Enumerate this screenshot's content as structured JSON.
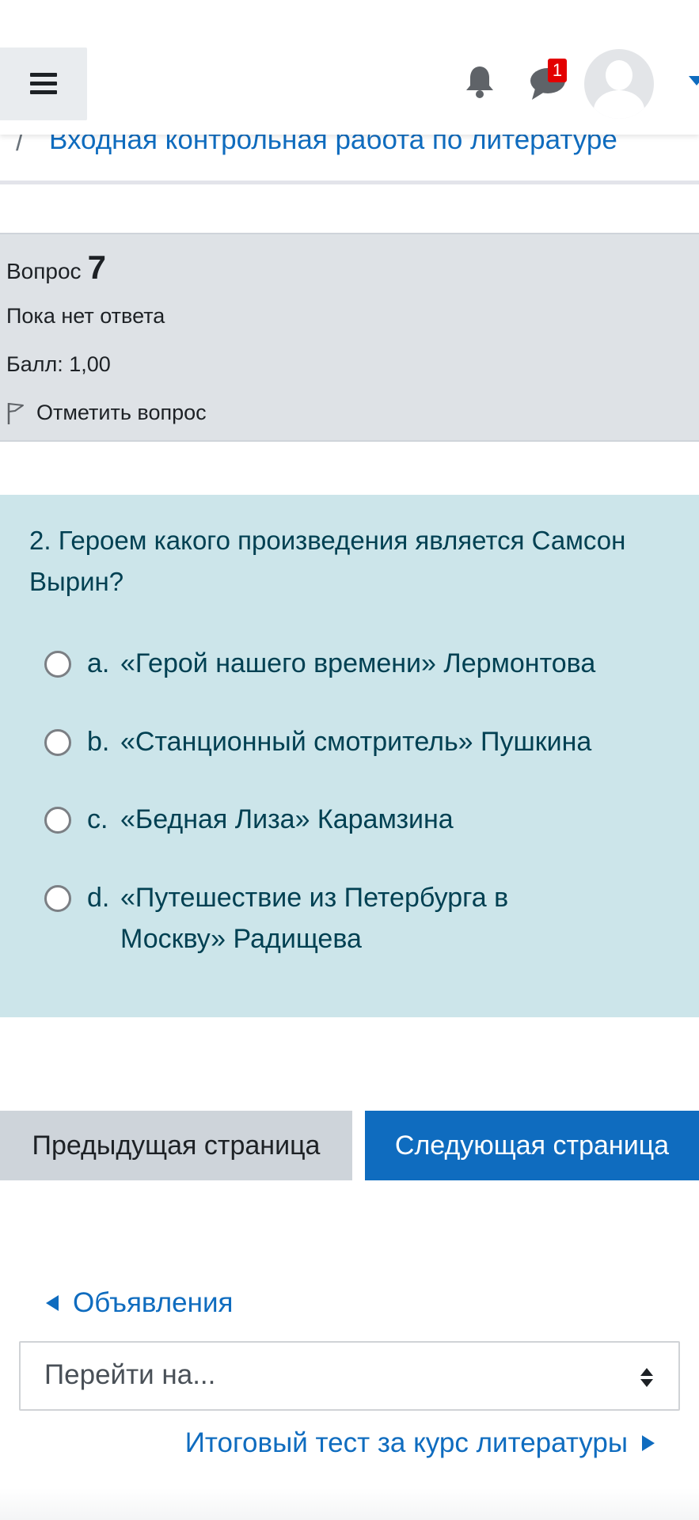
{
  "header": {
    "notification_count": "1",
    "icons": {
      "menu": "hamburger-icon",
      "notifications": "bell-icon",
      "messages": "chat-icon",
      "user": "avatar-icon",
      "user_menu": "chevron-down-icon"
    }
  },
  "breadcrumb": {
    "separator": "/",
    "current": "Входная контрольная работа по литературе"
  },
  "question_info": {
    "label": "Вопрос",
    "number": "7",
    "state": "Пока нет ответа",
    "grade": "Балл: 1,00",
    "flag_label": "Отметить вопрос"
  },
  "question": {
    "text": "2. Героем какого произведения является Самсон Вырин?",
    "answers": [
      {
        "letter": "a.",
        "text": "«Герой нашего времени» Лермонтова",
        "selected": false
      },
      {
        "letter": "b.",
        "text": "«Станционный смотритель» Пушкина",
        "selected": false
      },
      {
        "letter": "c.",
        "text": "«Бедная Лиза» Карамзина",
        "selected": false
      },
      {
        "letter": "d.",
        "text": "«Путешествие из Петербурга в Москву» Радищева",
        "selected": false
      }
    ]
  },
  "navigation": {
    "prev_page": "Предыдущая страница",
    "next_page": "Следующая страница"
  },
  "activity_nav": {
    "previous": "Объявления",
    "jump_placeholder": "Перейти на...",
    "next": "Итоговый тест за курс литературы"
  },
  "colors": {
    "primary": "#0f6cbf",
    "question_bg": "#cce5ea",
    "info_bg": "#dee2e6",
    "badge": "#e30000"
  }
}
